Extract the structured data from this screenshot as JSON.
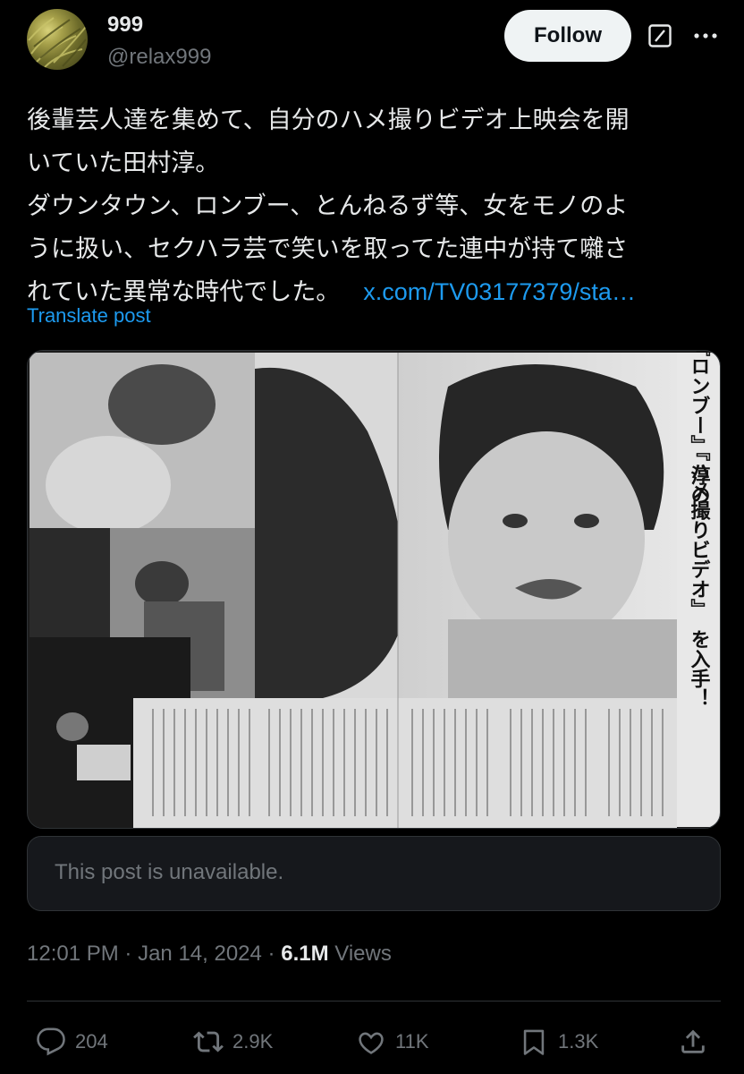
{
  "author": {
    "display_name": "999",
    "handle": "@relax999",
    "avatar_icon": "avatar-image"
  },
  "header": {
    "follow_label": "Follow",
    "grok_icon": "grok-icon",
    "more_icon": "more-icon"
  },
  "post": {
    "text_lines": [
      "後輩芸人達を集めて、自分のハメ撮りビデオ上映会を開",
      "いていた田村淳。",
      "ダウンタウン、ロンブー、とんねるず等、女をモノのよ",
      "うに扱い、セクハラ芸で笑いを取ってた連中が持て囃さ",
      "れていた異常な時代でした。"
    ],
    "link": "x.com/TV03177379/sta…",
    "translate_label": "Translate post"
  },
  "media": {
    "magazine_headline_lines": [
      "『ロンブー』",
      "淳の",
      "『ハメ撮りビデオ』",
      "を入手！"
    ]
  },
  "quote": {
    "text": "This post is unavailable."
  },
  "meta": {
    "time": "12:01 PM",
    "separator": "·",
    "date": "Jan 14, 2024",
    "views_count": "6.1M",
    "views_label": "Views"
  },
  "actions": {
    "replies": "204",
    "reposts": "2.9K",
    "likes": "11K",
    "bookmarks": "1.3K"
  },
  "colors": {
    "background": "#000000",
    "text_primary": "#e7e9ea",
    "text_secondary": "#71767b",
    "link": "#1d9bf0",
    "divider": "#2f3336",
    "follow_bg": "#eff3f4"
  }
}
